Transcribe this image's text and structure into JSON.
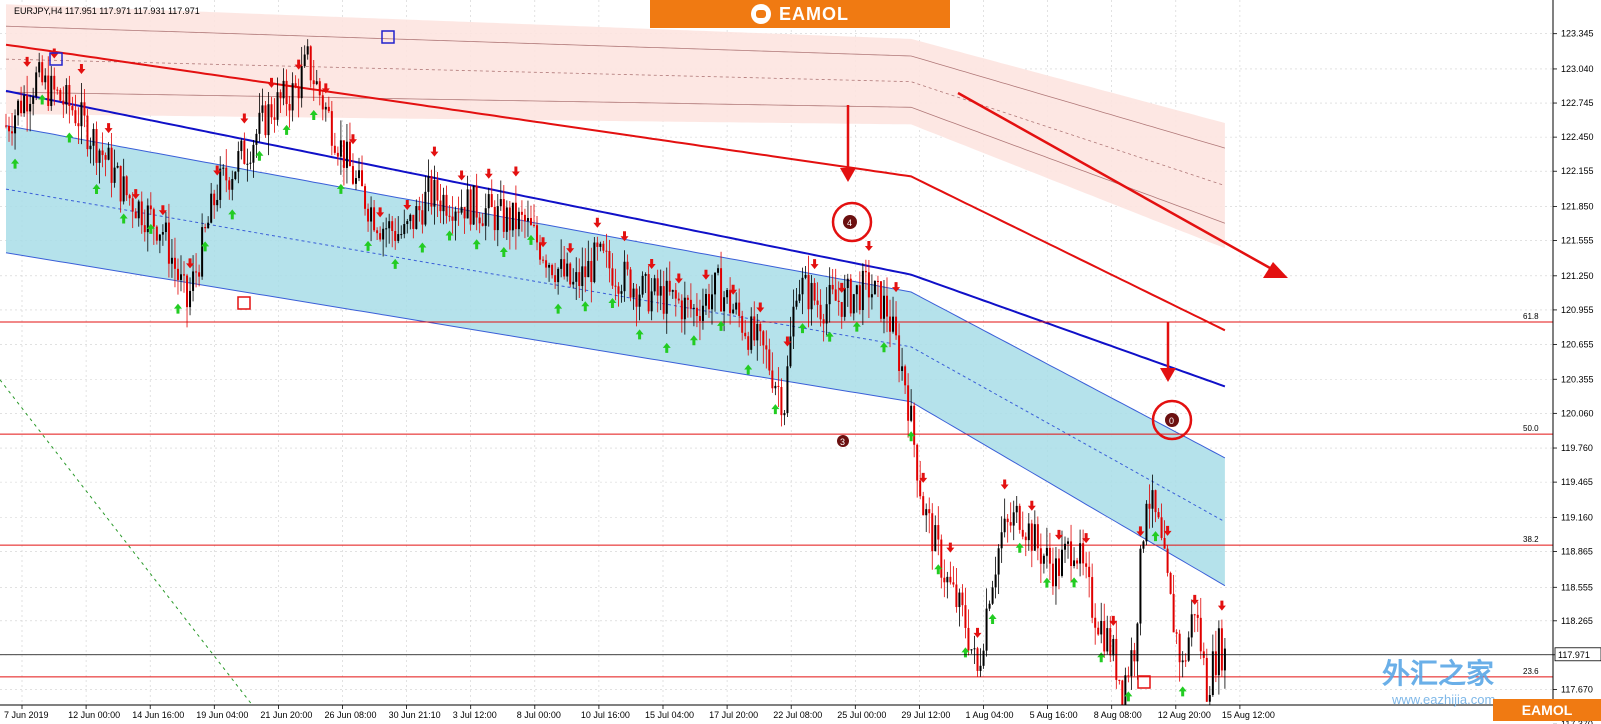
{
  "header": {
    "symbol_info": "EURJPY,H4 117.951 117.971 117.931 117.971"
  },
  "banner": {
    "brand": "EAMOL"
  },
  "watermark": {
    "text_cn": "外汇之家",
    "url": "www.eazhijia.com",
    "brand": "EAMOL"
  },
  "colors": {
    "bull_candle": "#000000",
    "bear_candle": "#e00000",
    "band_fill": "#a8dde8",
    "band_line": "#3a5fd8",
    "mid_line": "#1010c8",
    "upper_line": "#e31010",
    "upper_fill": "#fde4e0",
    "fib_line": "#e31010",
    "arrow_up": "#22cc22",
    "arrow_down": "#e31010",
    "annotation": "#e31010"
  },
  "chart_data": {
    "type": "candlestick",
    "symbol": "EURJPY",
    "timeframe": "H4",
    "ylim": [
      117.45,
      123.55
    ],
    "y_ticks": [
      "123.345",
      "123.040",
      "122.745",
      "122.450",
      "122.155",
      "121.850",
      "121.555",
      "121.250",
      "120.955",
      "120.655",
      "120.355",
      "120.060",
      "119.760",
      "119.465",
      "119.160",
      "118.865",
      "118.555",
      "118.265",
      "117.971",
      "117.670",
      "117.370"
    ],
    "current_price": "117.971",
    "x_ticks": [
      "7 Jun 2019",
      "12 Jun 00:00",
      "14 Jun 16:00",
      "19 Jun 04:00",
      "21 Jun 20:00",
      "26 Jun 08:00",
      "30 Jun 21:10",
      "3 Jul 12:00",
      "8 Jul 00:00",
      "10 Jul 16:00",
      "15 Jul 04:00",
      "17 Jul 20:00",
      "22 Jul 08:00",
      "25 Jul 00:00",
      "29 Jul 12:00",
      "1 Aug 04:00",
      "5 Aug 16:00",
      "8 Aug 08:00",
      "12 Aug 20:00",
      "15 Aug 12:00"
    ],
    "fib_levels": [
      {
        "label": "61.8",
        "price": 120.85
      },
      {
        "label": "50.0",
        "price": 119.88
      },
      {
        "label": "38.2",
        "price": 118.92
      },
      {
        "label": "23.6",
        "price": 117.78
      }
    ],
    "annotations": [
      {
        "label": "4"
      },
      {
        "label": "0"
      },
      {
        "label": "3"
      }
    ],
    "close_path": [
      [
        0,
        122.55
      ],
      [
        10,
        122.95
      ],
      [
        22,
        122.7
      ],
      [
        30,
        122.4
      ],
      [
        40,
        121.95
      ],
      [
        52,
        121.65
      ],
      [
        60,
        121.0
      ],
      [
        70,
        122.0
      ],
      [
        80,
        122.35
      ],
      [
        88,
        122.7
      ],
      [
        96,
        122.85
      ],
      [
        100,
        123.1
      ],
      [
        108,
        122.55
      ],
      [
        116,
        122.05
      ],
      [
        124,
        121.7
      ],
      [
        132,
        121.6
      ],
      [
        140,
        121.95
      ],
      [
        148,
        121.9
      ],
      [
        156,
        121.85
      ],
      [
        164,
        121.75
      ],
      [
        172,
        121.7
      ],
      [
        180,
        121.4
      ],
      [
        188,
        121.15
      ],
      [
        196,
        121.4
      ],
      [
        204,
        121.25
      ],
      [
        212,
        121.1
      ],
      [
        220,
        121.05
      ],
      [
        228,
        120.95
      ],
      [
        236,
        121.15
      ],
      [
        244,
        120.85
      ],
      [
        252,
        120.55
      ],
      [
        258,
        120.15
      ],
      [
        262,
        121.2
      ],
      [
        270,
        121.0
      ],
      [
        278,
        121.05
      ],
      [
        286,
        121.15
      ],
      [
        292,
        120.95
      ],
      [
        298,
        120.35
      ],
      [
        304,
        119.25
      ],
      [
        312,
        118.6
      ],
      [
        318,
        118.25
      ],
      [
        322,
        117.8
      ],
      [
        326,
        118.55
      ],
      [
        330,
        119.0
      ],
      [
        336,
        119.2
      ],
      [
        342,
        118.9
      ],
      [
        348,
        118.7
      ],
      [
        354,
        118.95
      ],
      [
        360,
        118.4
      ],
      [
        366,
        118.05
      ],
      [
        370,
        117.7
      ],
      [
        374,
        118.05
      ],
      [
        378,
        119.4
      ],
      [
        382,
        119.05
      ],
      [
        386,
        118.4
      ],
      [
        390,
        117.85
      ],
      [
        394,
        118.4
      ],
      [
        398,
        117.7
      ],
      [
        402,
        118.05
      ],
      [
        404,
        117.97
      ]
    ]
  }
}
